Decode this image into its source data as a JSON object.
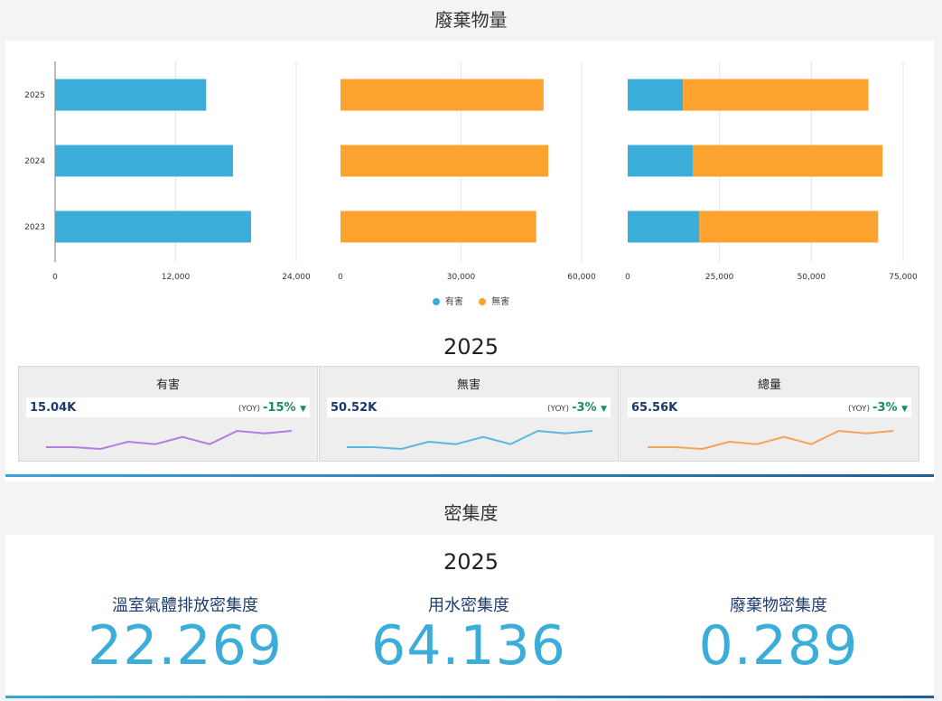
{
  "waste": {
    "title": "廢棄物量",
    "legend": [
      {
        "label": "有害",
        "color": "#3badd9"
      },
      {
        "label": "無害",
        "color": "#fca22f"
      }
    ]
  },
  "chart_data": [
    {
      "type": "bar",
      "orientation": "horizontal",
      "categories": [
        "2025",
        "2024",
        "2023"
      ],
      "series": [
        {
          "name": "有害",
          "values": [
            15040,
            17700,
            19500
          ],
          "color": "#3badd9"
        }
      ],
      "xlim": [
        0,
        24000
      ],
      "xticks": [
        "0",
        "12,000",
        "24,000"
      ]
    },
    {
      "type": "bar",
      "orientation": "horizontal",
      "categories": [
        "2025",
        "2024",
        "2023"
      ],
      "series": [
        {
          "name": "無害",
          "values": [
            50520,
            51700,
            48700
          ],
          "color": "#fca22f"
        }
      ],
      "xlim": [
        0,
        60000
      ],
      "xticks": [
        "0",
        "30,000",
        "60,000"
      ]
    },
    {
      "type": "bar",
      "orientation": "horizontal",
      "stacked": true,
      "categories": [
        "2025",
        "2024",
        "2023"
      ],
      "series": [
        {
          "name": "有害",
          "values": [
            15040,
            17700,
            19500
          ],
          "color": "#3badd9"
        },
        {
          "name": "無害",
          "values": [
            50520,
            51700,
            48700
          ],
          "color": "#fca22f"
        }
      ],
      "xlim": [
        0,
        75000
      ],
      "xticks": [
        "0",
        "25,000",
        "50,000",
        "75,000"
      ]
    }
  ],
  "kpi": {
    "year": "2025",
    "cards": [
      {
        "label": "有害",
        "value": "15.04K",
        "yoy_tag": "(YOY)",
        "yoy": "-15%",
        "arrow": "▼",
        "spark_color": "#b57be0",
        "spark": [
          0.5,
          0.5,
          0.2,
          1.4,
          1.0,
          2.2,
          1.0,
          3.2,
          2.8,
          3.2
        ]
      },
      {
        "label": "無害",
        "value": "50.52K",
        "yoy_tag": "(YOY)",
        "yoy": "-3%",
        "arrow": "▼",
        "spark_color": "#5bb7e0",
        "spark": [
          0.5,
          0.5,
          0.2,
          1.4,
          1.0,
          2.2,
          1.0,
          3.2,
          2.8,
          3.2
        ]
      },
      {
        "label": "總量",
        "value": "65.56K",
        "yoy_tag": "(YOY)",
        "yoy": "-3%",
        "arrow": "▼",
        "spark_color": "#f5a35a",
        "spark": [
          0.5,
          0.5,
          0.2,
          1.4,
          1.0,
          2.2,
          1.0,
          3.2,
          2.8,
          3.2
        ]
      }
    ]
  },
  "intensity": {
    "title": "密集度",
    "year": "2025",
    "items": [
      {
        "label": "溫室氣體排放密集度",
        "value": "22.269"
      },
      {
        "label": "用水密集度",
        "value": "64.136"
      },
      {
        "label": "廢棄物密集度",
        "value": "0.289"
      }
    ]
  }
}
